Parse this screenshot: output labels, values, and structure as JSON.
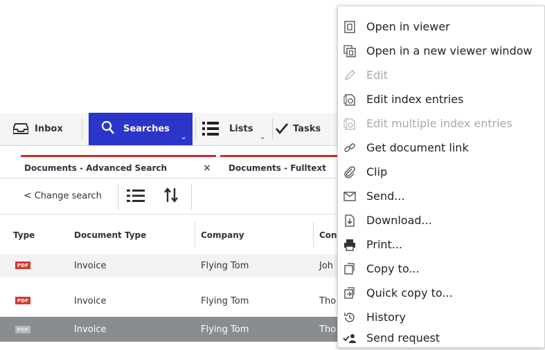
{
  "nav": {
    "inbox": "Inbox",
    "searches": "Searches",
    "lists": "Lists",
    "tasks": "Tasks",
    "active_color": "#2c35c9"
  },
  "tabs": [
    {
      "label": "Documents - Advanced Search",
      "close": "×"
    },
    {
      "label": "Documents - Fulltext"
    }
  ],
  "toolbar": {
    "change_search": "Change search",
    "chevron": "<"
  },
  "table": {
    "columns": [
      "Type",
      "Document Type",
      "Company",
      "Con"
    ],
    "rows": [
      {
        "type_badge": "PDF",
        "doc_type": "Invoice",
        "company": "Flying Tom",
        "contact": "Joh",
        "selected": false
      },
      {
        "type_badge": "PDF",
        "doc_type": "Invoice",
        "company": "Flying Tom",
        "contact": "Tho",
        "selected": false
      },
      {
        "type_badge": "PDF",
        "doc_type": "Invoice",
        "company": "Flying Tom",
        "contact": "Tho",
        "selected": true
      }
    ],
    "selected_row_color": "#8a8d90",
    "alt_row_color": "#f2f2f2"
  },
  "context_menu": {
    "items": [
      {
        "label": "Open in viewer",
        "icon": "document-viewer-icon",
        "disabled": false
      },
      {
        "label": "Open in a new viewer window",
        "icon": "new-window-icon",
        "disabled": false
      },
      {
        "label": "Edit",
        "icon": "pencil-icon",
        "disabled": true
      },
      {
        "label": "Edit index entries",
        "icon": "index-entries-icon",
        "disabled": false
      },
      {
        "label": "Edit multiple index entries",
        "icon": "multi-index-icon",
        "disabled": true
      },
      {
        "label": "Get document link",
        "icon": "link-icon",
        "disabled": false
      },
      {
        "label": "Clip",
        "icon": "paperclip-icon",
        "disabled": false
      },
      {
        "label": "Send...",
        "icon": "envelope-icon",
        "disabled": false
      },
      {
        "label": "Download...",
        "icon": "download-icon",
        "disabled": false
      },
      {
        "label": "Print...",
        "icon": "printer-icon",
        "disabled": false
      },
      {
        "label": "Copy to...",
        "icon": "copy-icon",
        "disabled": false
      },
      {
        "label": "Quick copy to...",
        "icon": "quick-copy-icon",
        "disabled": false
      },
      {
        "label": "History",
        "icon": "history-icon",
        "disabled": false
      },
      {
        "label": "Send request",
        "icon": "send-request-icon",
        "disabled": false
      }
    ]
  },
  "colors": {
    "tab_accent": "#cf2a2a",
    "pdf_badge": "#d23a2b"
  }
}
